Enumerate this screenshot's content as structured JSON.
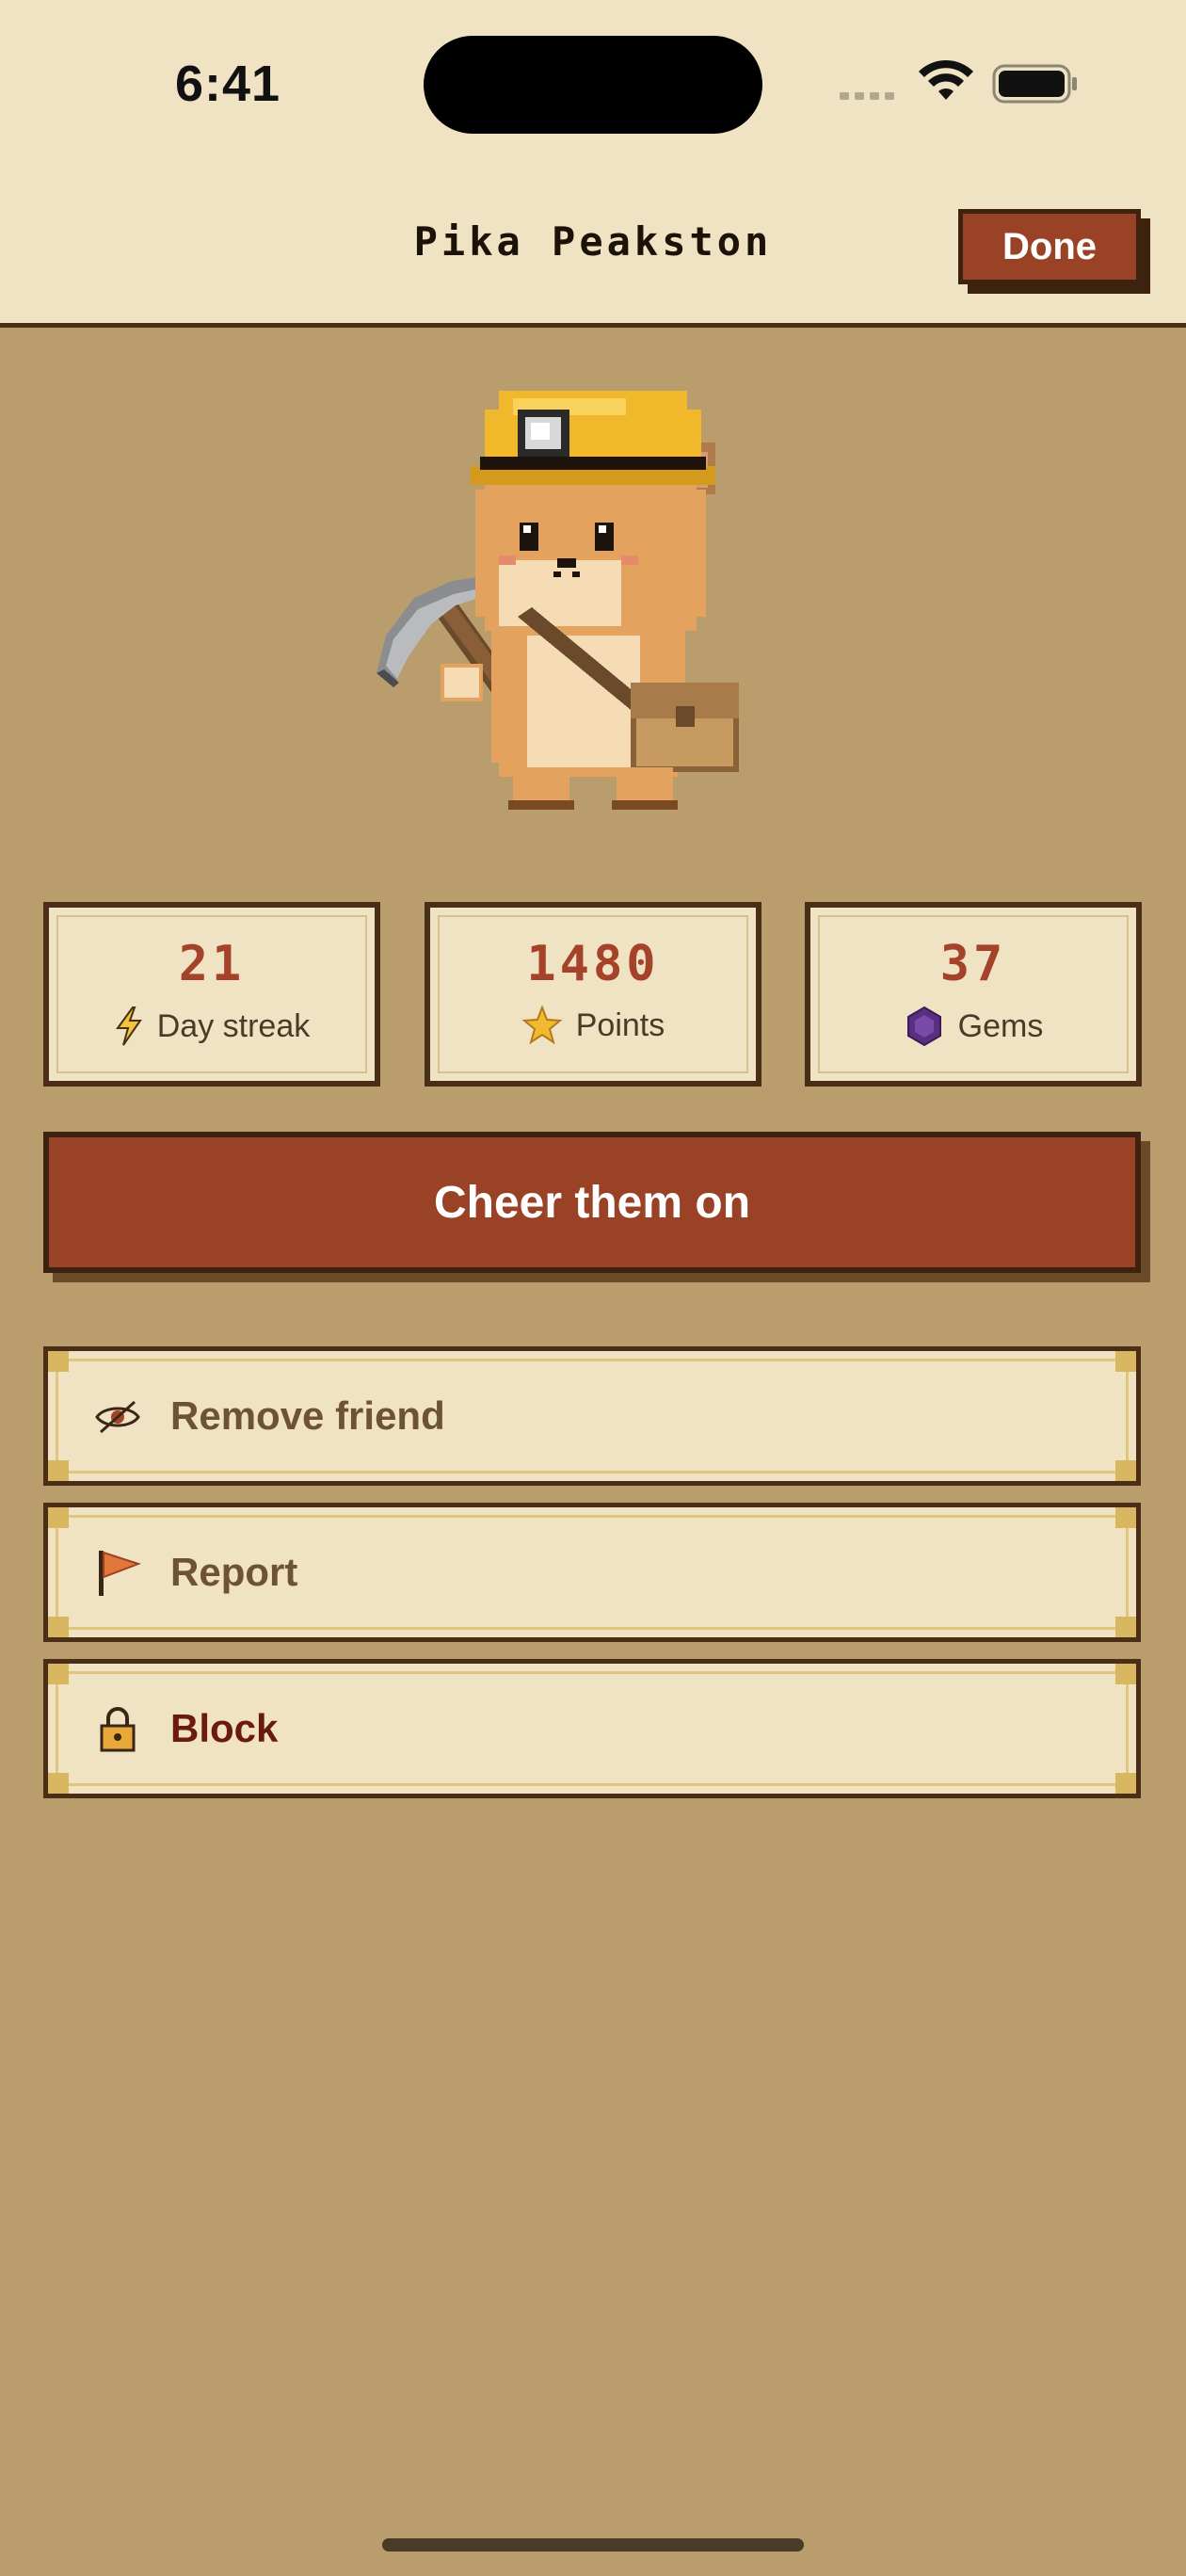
{
  "status_bar": {
    "time": "6:41"
  },
  "nav": {
    "title": "Pika Peakston",
    "done_label": "Done"
  },
  "stats": [
    {
      "value": "21",
      "label": "Day streak",
      "icon": "lightning-icon"
    },
    {
      "value": "1480",
      "label": "Points",
      "icon": "star-icon"
    },
    {
      "value": "37",
      "label": "Gems",
      "icon": "gem-icon"
    }
  ],
  "cheer": {
    "label": "Cheer them on"
  },
  "actions": [
    {
      "label": "Remove friend",
      "icon": "eye-slash-icon"
    },
    {
      "label": "Report",
      "icon": "flag-icon"
    },
    {
      "label": "Block",
      "icon": "lock-icon"
    }
  ],
  "colors": {
    "background": "#b99d6c",
    "header": "#f0e3c4",
    "primary_button": "#9a4226",
    "border": "#4a2e17",
    "stat_value": "#a5432a",
    "block_text": "#6b1a0e"
  }
}
